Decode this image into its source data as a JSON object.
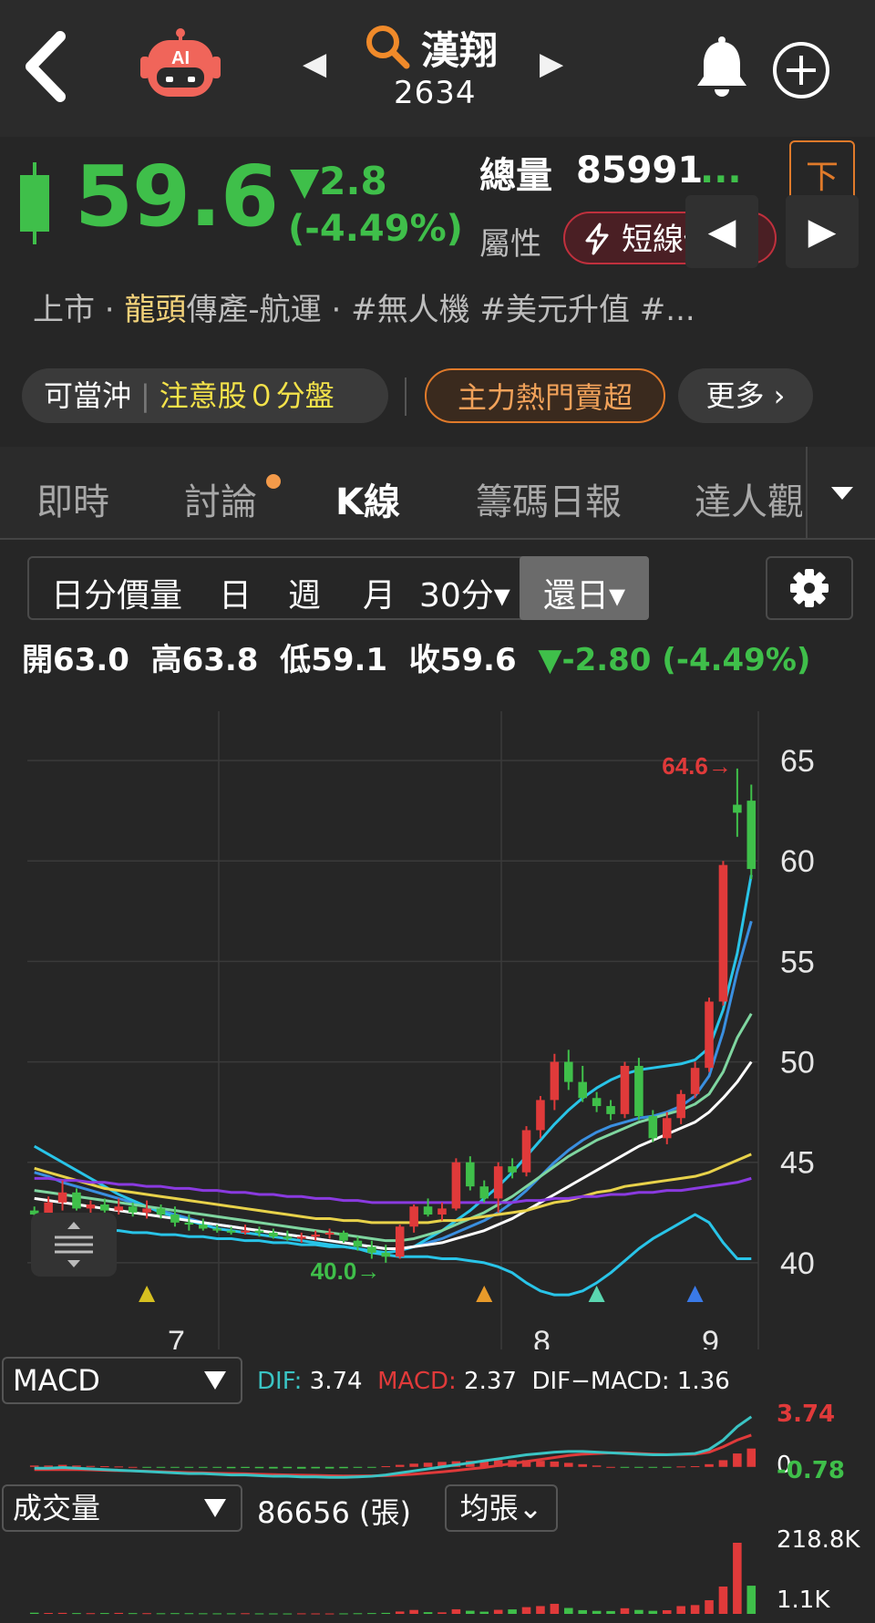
{
  "header": {
    "stock_name": "漢翔",
    "stock_code": "2634",
    "prev_arrow": "◀",
    "next_arrow": "▶"
  },
  "quote": {
    "price": "59.6",
    "change": "▼2.8",
    "change_pct": "(-4.49%)",
    "volume_label": "總量",
    "volume_value": "85991",
    "volume_more": "...",
    "attr_label": "屬性",
    "attr_badge": "短線價差",
    "order_label": "下單",
    "scroll_prev": "◀",
    "scroll_next": "▶",
    "colors": {
      "down": "#3fbf4a",
      "up": "#e03a3a"
    }
  },
  "tags": {
    "market": "上市",
    "dot1": " · ",
    "category_hl": "龍頭",
    "category": "傳產-航運",
    "dot2": " · ",
    "t1": "#無人機",
    "t2": "#美元升值",
    "t3": "#..."
  },
  "chips": {
    "day_trade": "可當沖",
    "attention": "注意股０分盤",
    "hot_sell": "主力熱門賣超",
    "more": "更多 ›"
  },
  "tabs": [
    {
      "label": "即時"
    },
    {
      "label": "討論"
    },
    {
      "label": "K線"
    },
    {
      "label": "籌碼日報"
    },
    {
      "label": "達人觀"
    }
  ],
  "periods": {
    "intraday": "日分價量",
    "day": "日",
    "week": "週",
    "month": "月",
    "min30": "30分▾",
    "restore": "還日▾"
  },
  "ohlc": {
    "open_label": "開",
    "open": "63.0",
    "high_label": "高",
    "high": "63.8",
    "low_label": "低",
    "low": "59.1",
    "close_label": "收",
    "close": "59.6",
    "change": "▼-2.80 (-4.49%)"
  },
  "chart_data": {
    "type": "candlestick",
    "y_ticks": [
      "65",
      "60",
      "55",
      "50",
      "45",
      "40"
    ],
    "ylim": [
      37.5,
      67
    ],
    "x_ticks": [
      "7",
      "8",
      "9"
    ],
    "max_label": "64.6→",
    "min_label": "40.0→",
    "max_value": 64.6,
    "min_value": 40.0,
    "candles": [
      [
        42.6,
        42.8,
        42.2,
        42.4
      ],
      [
        42.4,
        43.3,
        42.2,
        43.0
      ],
      [
        43.0,
        44.1,
        42.6,
        43.5
      ],
      [
        43.5,
        43.7,
        42.6,
        42.7
      ],
      [
        42.7,
        43.1,
        42.3,
        42.9
      ],
      [
        42.9,
        43.2,
        42.5,
        42.6
      ],
      [
        42.6,
        43.2,
        42.4,
        42.8
      ],
      [
        42.8,
        43.0,
        42.3,
        42.5
      ],
      [
        42.5,
        43.1,
        42.2,
        42.7
      ],
      [
        42.7,
        42.9,
        42.2,
        42.4
      ],
      [
        42.4,
        42.8,
        41.8,
        42.0
      ],
      [
        42.0,
        42.4,
        41.6,
        41.9
      ],
      [
        41.9,
        42.2,
        41.6,
        41.7
      ],
      [
        41.7,
        41.9,
        41.5,
        41.6
      ],
      [
        41.6,
        41.8,
        41.4,
        41.5
      ],
      [
        41.5,
        41.9,
        41.4,
        41.6
      ],
      [
        41.6,
        41.8,
        41.3,
        41.5
      ],
      [
        41.5,
        41.7,
        41.2,
        41.3
      ],
      [
        41.3,
        41.6,
        41.1,
        41.2
      ],
      [
        41.2,
        41.5,
        41.0,
        41.3
      ],
      [
        41.3,
        41.6,
        41.1,
        41.4
      ],
      [
        41.4,
        41.7,
        41.2,
        41.5
      ],
      [
        41.5,
        41.6,
        41.0,
        41.1
      ],
      [
        41.1,
        41.3,
        40.6,
        40.8
      ],
      [
        40.8,
        41.1,
        40.2,
        40.5
      ],
      [
        40.5,
        40.9,
        40.0,
        40.3
      ],
      [
        40.3,
        41.9,
        40.2,
        41.8
      ],
      [
        41.8,
        42.9,
        41.5,
        42.8
      ],
      [
        42.8,
        43.2,
        42.3,
        42.4
      ],
      [
        42.4,
        43.0,
        42.1,
        42.7
      ],
      [
        42.7,
        45.2,
        42.6,
        45.0
      ],
      [
        45.0,
        45.3,
        43.6,
        43.8
      ],
      [
        43.8,
        44.1,
        43.0,
        43.2
      ],
      [
        43.2,
        45.0,
        42.5,
        44.8
      ],
      [
        44.8,
        45.2,
        44.2,
        44.5
      ],
      [
        44.5,
        46.8,
        44.3,
        46.6
      ],
      [
        46.6,
        48.3,
        46.2,
        48.1
      ],
      [
        48.1,
        50.4,
        47.6,
        50.0
      ],
      [
        50.0,
        50.6,
        48.6,
        49.0
      ],
      [
        49.0,
        49.8,
        48.0,
        48.2
      ],
      [
        48.2,
        48.5,
        47.5,
        47.8
      ],
      [
        47.8,
        48.1,
        47.1,
        47.4
      ],
      [
        47.4,
        50.0,
        47.2,
        49.8
      ],
      [
        49.8,
        50.2,
        47.1,
        47.3
      ],
      [
        47.3,
        47.6,
        46.0,
        46.2
      ],
      [
        46.2,
        47.5,
        45.9,
        47.2
      ],
      [
        47.2,
        48.6,
        46.9,
        48.4
      ],
      [
        48.4,
        50.0,
        48.2,
        49.7
      ],
      [
        49.7,
        53.2,
        49.5,
        53.0
      ],
      [
        53.0,
        60.0,
        52.8,
        59.8
      ],
      [
        62.8,
        64.6,
        61.2,
        62.4
      ],
      [
        63.0,
        63.8,
        59.1,
        59.6
      ]
    ],
    "series": [
      {
        "values": [
          44.5,
          44.3,
          44.0,
          43.8,
          43.6,
          43.4,
          43.2,
          43.0,
          42.8,
          42.6,
          42.4,
          42.2,
          42.0,
          41.9,
          41.8,
          41.7,
          41.6,
          41.5,
          41.4,
          41.3,
          41.2,
          41.1,
          41.0,
          40.9,
          40.8,
          40.7,
          40.7,
          40.8,
          41.0,
          41.2,
          41.5,
          41.8,
          42.1,
          42.5,
          43.0,
          43.6,
          44.3,
          45.0,
          45.6,
          46.1,
          46.5,
          46.8,
          47.0,
          47.2,
          47.3,
          47.5,
          47.8,
          48.3,
          49.3,
          51.5,
          54.5,
          57.0
        ],
        "color": "#3a8fe0"
      },
      {
        "values": [
          45.8,
          45.4,
          45.0,
          44.6,
          44.2,
          43.8,
          43.4,
          43.1,
          42.8,
          42.5,
          42.3,
          42.1,
          41.9,
          41.7,
          41.6,
          41.5,
          41.4,
          41.3,
          41.2,
          41.1,
          41.0,
          40.9,
          40.8,
          40.7,
          40.6,
          40.5,
          40.6,
          40.8,
          41.2,
          41.6,
          42.1,
          42.6,
          43.2,
          43.8,
          44.5,
          45.3,
          46.1,
          46.9,
          47.6,
          48.2,
          48.7,
          49.1,
          49.4,
          49.6,
          49.7,
          49.8,
          49.9,
          50.1,
          50.7,
          52.6,
          55.4,
          59.3
        ],
        "color": "#29c4e8"
      },
      {
        "values": [
          43.6,
          43.5,
          43.4,
          43.3,
          43.2,
          43.1,
          43.0,
          42.9,
          42.8,
          42.7,
          42.6,
          42.5,
          42.4,
          42.3,
          42.2,
          42.1,
          42.0,
          41.9,
          41.8,
          41.7,
          41.6,
          41.5,
          41.4,
          41.3,
          41.2,
          41.1,
          41.1,
          41.2,
          41.4,
          41.6,
          41.9,
          42.2,
          42.5,
          42.9,
          43.3,
          43.8,
          44.3,
          44.8,
          45.3,
          45.7,
          46.1,
          46.4,
          46.7,
          47.0,
          47.2,
          47.4,
          47.6,
          47.9,
          48.4,
          49.5,
          51.2,
          52.4
        ],
        "color": "#7fd6a0"
      },
      {
        "values": [
          43.2,
          43.1,
          43.0,
          42.9,
          42.8,
          42.7,
          42.6,
          42.5,
          42.4,
          42.3,
          42.2,
          42.1,
          42.0,
          41.9,
          41.8,
          41.7,
          41.6,
          41.5,
          41.4,
          41.3,
          41.2,
          41.1,
          41.0,
          40.9,
          40.8,
          40.7,
          40.7,
          40.8,
          40.9,
          41.0,
          41.2,
          41.4,
          41.6,
          41.9,
          42.2,
          42.6,
          43.0,
          43.4,
          43.8,
          44.2,
          44.6,
          45.0,
          45.4,
          45.8,
          46.1,
          46.4,
          46.7,
          47.0,
          47.5,
          48.2,
          49.0,
          50.0
        ],
        "color": "#ffffff"
      },
      {
        "values": [
          44.7,
          44.5,
          44.3,
          44.1,
          43.9,
          43.7,
          43.6,
          43.5,
          43.4,
          43.3,
          43.2,
          43.1,
          43.0,
          42.9,
          42.8,
          42.7,
          42.6,
          42.5,
          42.4,
          42.3,
          42.2,
          42.2,
          42.1,
          42.1,
          42.0,
          42.0,
          42.0,
          42.0,
          42.0,
          42.1,
          42.1,
          42.2,
          42.3,
          42.4,
          42.5,
          42.6,
          42.8,
          43.0,
          43.1,
          43.3,
          43.5,
          43.6,
          43.8,
          43.9,
          44.0,
          44.1,
          44.2,
          44.3,
          44.5,
          44.8,
          45.1,
          45.4
        ],
        "color": "#e8d24a"
      },
      {
        "values": [
          44.2,
          44.2,
          44.1,
          44.1,
          44.0,
          44.0,
          43.9,
          43.9,
          43.8,
          43.8,
          43.7,
          43.7,
          43.6,
          43.6,
          43.5,
          43.5,
          43.4,
          43.4,
          43.3,
          43.3,
          43.2,
          43.2,
          43.1,
          43.1,
          43.0,
          43.0,
          43.0,
          43.0,
          43.0,
          43.0,
          43.0,
          43.0,
          43.0,
          43.0,
          43.0,
          43.1,
          43.1,
          43.2,
          43.2,
          43.3,
          43.3,
          43.4,
          43.4,
          43.5,
          43.5,
          43.6,
          43.6,
          43.7,
          43.8,
          43.9,
          44.0,
          44.2
        ],
        "color": "#8a3ae0"
      },
      {
        "values": [
          42.0,
          41.9,
          41.8,
          41.8,
          41.7,
          41.6,
          41.6,
          41.5,
          41.5,
          41.4,
          41.4,
          41.3,
          41.3,
          41.2,
          41.2,
          41.1,
          41.1,
          41.0,
          41.0,
          40.9,
          40.9,
          40.8,
          40.8,
          40.7,
          40.5,
          40.4,
          40.3,
          40.3,
          40.3,
          40.2,
          40.2,
          40.1,
          40.0,
          39.8,
          39.5,
          39.0,
          38.6,
          38.4,
          38.4,
          38.6,
          39.0,
          39.5,
          40.1,
          40.7,
          41.2,
          41.6,
          42.0,
          42.4,
          42.0,
          41.0,
          40.2,
          40.2
        ],
        "color": "#29c4e8"
      }
    ],
    "signals": [
      {
        "index": 8,
        "color": "#d6c020"
      },
      {
        "index": 32,
        "color": "#e89a2a"
      },
      {
        "index": 40,
        "color": "#5ad6b0"
      },
      {
        "index": 47,
        "color": "#3a7ae8"
      }
    ]
  },
  "macd": {
    "selector": "MACD",
    "dif_label": "DIF:",
    "dif": "3.74",
    "macd_label": "MACD:",
    "macd": "2.37",
    "diff_label": "DIF−MACD:",
    "diff": "1.36",
    "axis_top": "3.74",
    "axis_zero": "0",
    "axis_bottom": "-0.78",
    "dif_values": [
      -0.1,
      -0.1,
      -0.05,
      -0.1,
      -0.15,
      -0.2,
      -0.25,
      -0.3,
      -0.35,
      -0.4,
      -0.45,
      -0.5,
      -0.5,
      -0.55,
      -0.6,
      -0.6,
      -0.65,
      -0.7,
      -0.7,
      -0.75,
      -0.75,
      -0.78,
      -0.78,
      -0.75,
      -0.7,
      -0.6,
      -0.45,
      -0.3,
      -0.15,
      0.0,
      0.15,
      0.3,
      0.45,
      0.6,
      0.75,
      0.9,
      1.0,
      1.1,
      1.15,
      1.15,
      1.1,
      1.05,
      1.0,
      0.95,
      0.9,
      0.9,
      0.95,
      1.0,
      1.3,
      2.0,
      3.0,
      3.74
    ],
    "macd_values": [
      -0.2,
      -0.2,
      -0.2,
      -0.2,
      -0.22,
      -0.25,
      -0.28,
      -0.3,
      -0.33,
      -0.36,
      -0.4,
      -0.43,
      -0.45,
      -0.48,
      -0.5,
      -0.52,
      -0.55,
      -0.58,
      -0.6,
      -0.62,
      -0.64,
      -0.66,
      -0.68,
      -0.68,
      -0.67,
      -0.65,
      -0.6,
      -0.54,
      -0.46,
      -0.37,
      -0.27,
      -0.15,
      -0.05,
      0.1,
      0.25,
      0.4,
      0.55,
      0.7,
      0.85,
      0.95,
      1.0,
      1.05,
      1.05,
      1.0,
      0.95,
      0.92,
      0.92,
      0.95,
      1.1,
      1.5,
      2.0,
      2.37
    ]
  },
  "volume": {
    "selector": "成交量",
    "total": "86656 (張)",
    "avg_btn": "均張⌄",
    "axis_max": "218.8K",
    "axis_min": "1.1K",
    "values": [
      3.6,
      2.8,
      3.1,
      2.5,
      2.2,
      2.6,
      3.0,
      2.4,
      2.2,
      1.9,
      2.3,
      2.1,
      1.8,
      1.6,
      1.7,
      2.0,
      1.5,
      1.4,
      1.3,
      1.6,
      1.4,
      1.3,
      1.5,
      2.0,
      2.5,
      3.1,
      7.3,
      12.1,
      5.2,
      4.7,
      14.2,
      9.6,
      6.8,
      12.5,
      13.8,
      20.7,
      24.0,
      31.0,
      18.2,
      11.5,
      9.2,
      8.7,
      17.3,
      12.1,
      9.4,
      11.2,
      23.9,
      27.1,
      42.0,
      84.1,
      218.8,
      86.7
    ],
    "up": [
      0,
      1,
      1,
      0,
      1,
      0,
      1,
      0,
      1,
      0,
      0,
      0,
      0,
      0,
      0,
      1,
      0,
      0,
      0,
      1,
      1,
      1,
      0,
      0,
      0,
      0,
      1,
      1,
      0,
      1,
      1,
      0,
      0,
      1,
      0,
      1,
      1,
      1,
      0,
      0,
      0,
      0,
      1,
      0,
      0,
      1,
      1,
      1,
      1,
      1,
      1,
      0
    ]
  }
}
